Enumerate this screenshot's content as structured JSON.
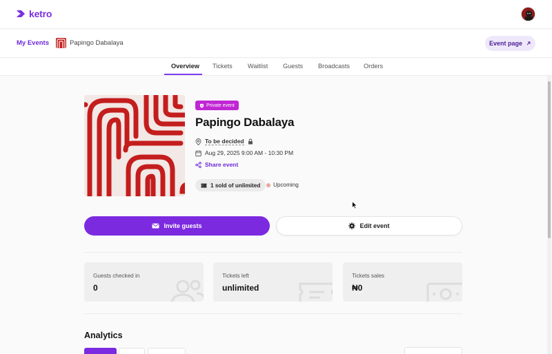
{
  "app": {
    "brand": "ketro",
    "brand_color": "#7c2ae0"
  },
  "header": {
    "avatar_icon": "user-avatar"
  },
  "breadcrumb": {
    "root": "My Events",
    "current": "Papingo Dabalaya",
    "event_page_label": "Event page"
  },
  "tabs": [
    {
      "label": "Overview",
      "active": true
    },
    {
      "label": "Tickets"
    },
    {
      "label": "Waitlist"
    },
    {
      "label": "Guests"
    },
    {
      "label": "Broadcasts"
    },
    {
      "label": "Orders"
    }
  ],
  "event": {
    "privacy_badge": "Private event",
    "title": "Papingo Dabalaya",
    "location": "To be decided",
    "datetime": "Aug 29, 2025 9:00 AM - 10:30 PM",
    "share_label": "Share event",
    "sold_label": "1 sold of unlimited",
    "status_label": "Upcoming",
    "status_color": "#e6a99c"
  },
  "actions": {
    "invite_label": "Invite guests",
    "edit_label": "Edit event"
  },
  "stats": [
    {
      "label": "Guests checked in",
      "value": "0",
      "icon": "users-icon"
    },
    {
      "label": "Tickets left",
      "value": "unlimited",
      "icon": "ticket-icon"
    },
    {
      "label": "Tickets sales",
      "value": "₦0",
      "icon": "cash-icon"
    }
  ],
  "analytics": {
    "title": "Analytics"
  }
}
